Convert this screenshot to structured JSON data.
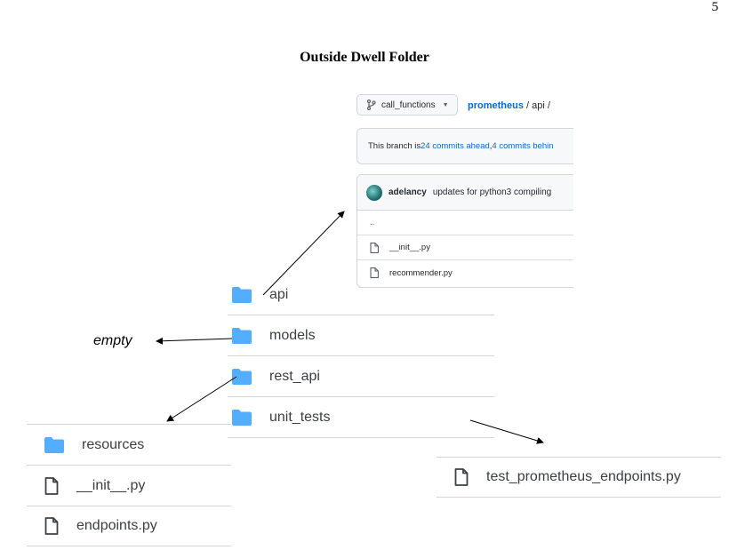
{
  "page_number": "5",
  "title": "Outside Dwell Folder",
  "github": {
    "branch": "call_functions",
    "breadcrumb_repo": "prometheus",
    "breadcrumb_rest": " / api /",
    "branch_info_prefix": "This branch is ",
    "commits_ahead": "24 commits ahead",
    "branch_info_sep": ", ",
    "commits_behind": "4 commits behin",
    "commit_author": "adelancy",
    "commit_message": "updates for python3 compiling",
    "parent_dir": "..",
    "files": [
      "__init__.py",
      "recommender.py"
    ]
  },
  "explorer_main": {
    "folders": [
      "api",
      "models",
      "rest_api",
      "unit_tests"
    ]
  },
  "empty_annotation": "empty",
  "rest_api_contents": {
    "folder": "resources",
    "files": [
      "__init__.py",
      "endpoints.py"
    ]
  },
  "unit_tests_contents": {
    "files": [
      "test_prometheus_endpoints.py"
    ]
  },
  "colors": {
    "folder": "#54aeff",
    "link": "#0969da",
    "border": "#d0d7de"
  }
}
